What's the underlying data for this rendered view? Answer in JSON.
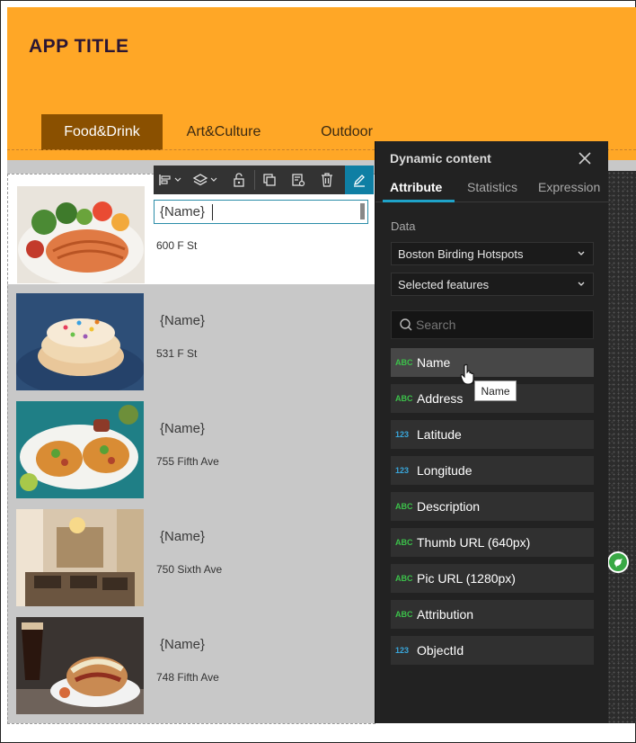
{
  "app": {
    "title": "APP TITLE"
  },
  "tabs": [
    {
      "label": "Food&Drink",
      "active": true
    },
    {
      "label": "Art&Culture",
      "active": false
    },
    {
      "label": "Outdoor",
      "active": false
    }
  ],
  "list": [
    {
      "name": "{Name}",
      "address": "600 F St",
      "selected": true
    },
    {
      "name": "{Name}",
      "address": "531 F St"
    },
    {
      "name": "{Name}",
      "address": "755 Fifth Ave"
    },
    {
      "name": "{Name}",
      "address": "750 Sixth Ave"
    },
    {
      "name": "{Name}",
      "address": "748 Fifth Ave"
    }
  ],
  "editor": {
    "value": "{Name}"
  },
  "toolbar_icons": [
    "align-icon",
    "layers-icon",
    "unlock-icon",
    "duplicate-icon",
    "edit-item-icon",
    "delete-icon",
    "pencil-icon"
  ],
  "panel": {
    "title": "Dynamic content",
    "tabs": [
      {
        "label": "Attribute",
        "active": true
      },
      {
        "label": "Statistics"
      },
      {
        "label": "Expression"
      }
    ],
    "data_label": "Data",
    "data_source": "Boston Birding Hotspots",
    "feature_scope": "Selected features",
    "search_placeholder": "Search",
    "fields": [
      {
        "type": "ABC",
        "label": "Name"
      },
      {
        "type": "ABC",
        "label": "Address"
      },
      {
        "type": "123",
        "label": "Latitude"
      },
      {
        "type": "123",
        "label": "Longitude"
      },
      {
        "type": "ABC",
        "label": "Description"
      },
      {
        "type": "ABC",
        "label": "Thumb URL (640px)"
      },
      {
        "type": "ABC",
        "label": "Pic URL (1280px)"
      },
      {
        "type": "ABC",
        "label": "Attribution"
      },
      {
        "type": "123",
        "label": "ObjectId"
      }
    ],
    "tooltip": "Name"
  },
  "colors": {
    "header": "#ffa726",
    "active_tab": "#8a5000",
    "accent": "#1fa3c9",
    "panel": "#222222",
    "abc_type": "#3cc04a",
    "num_type": "#39a7dc"
  }
}
